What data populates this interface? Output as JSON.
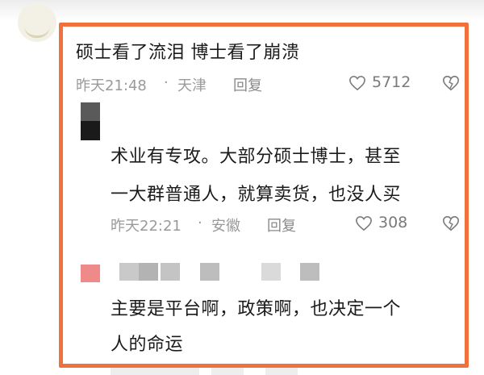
{
  "comment1": {
    "text": "硕士看了流泪 博士看了崩溃",
    "time": "昨天21:48",
    "dot": "·",
    "location": "天津",
    "reply_label": "回复",
    "likes": "5712"
  },
  "comment2": {
    "line1": "术业有专攻。大部分硕士博士，甚至",
    "line2": "一大群普通人，就算卖货，也没人买",
    "time": "昨天22:21",
    "dot": "·",
    "location": "安徽",
    "reply_label": "回复",
    "likes": "308"
  },
  "comment3": {
    "line1": "主要是平台啊，政策啊，也决定一个",
    "line2": "人的命运"
  },
  "colors": {
    "highlight": "#f0713b",
    "meta": "#9a9a9a"
  }
}
